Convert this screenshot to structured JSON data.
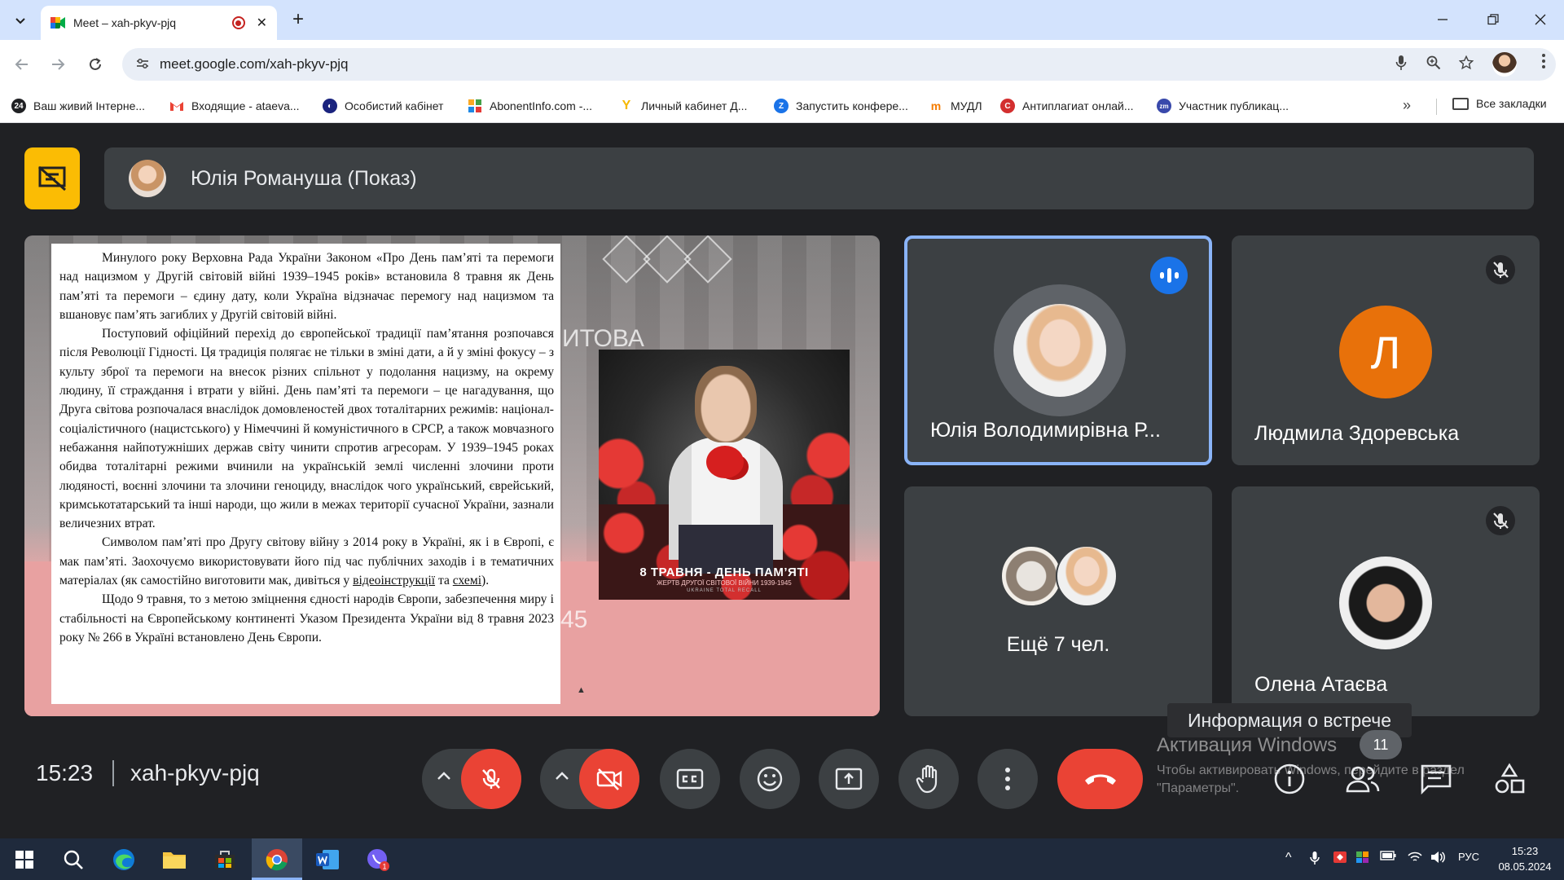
{
  "browser": {
    "tab_title": "Meet – xah-pkyv-pjq",
    "tab_close": "✕",
    "new_tab": "+",
    "url": "meet.google.com/xah-pkyv-pjq",
    "window": {
      "minimize": "—",
      "restore": "❐",
      "close": "✕"
    }
  },
  "bookmarks": {
    "items": [
      {
        "label": "Ваш живий Інтерне...",
        "icon": "24-icon",
        "color": "#202124"
      },
      {
        "label": "Входящие - ataeva...",
        "icon": "gmail-icon",
        "color": "#ea4335"
      },
      {
        "label": "Особистий кабінет",
        "icon": "globe-icon",
        "color": "#1a237e"
      },
      {
        "label": "AbonentInfo.com -...",
        "icon": "grid-icon",
        "color": "#f9a825"
      },
      {
        "label": "Личный кабинет Д...",
        "icon": "y-icon",
        "color": "#f6b800"
      },
      {
        "label": "Запустить конфере...",
        "icon": "z-icon",
        "color": "#1a73e8"
      },
      {
        "label": "МУДЛ",
        "icon": "moodle-icon",
        "color": "#f57c00"
      },
      {
        "label": "Антиплагиат онлай...",
        "icon": "c-icon",
        "color": "#d32f2f"
      },
      {
        "label": "Участник публикац...",
        "icon": "zm-icon",
        "color": "#3949ab"
      }
    ],
    "more": "»",
    "all": "Все закладки"
  },
  "meet": {
    "presenter_label": "Юлія Романуша (Показ)",
    "slide": {
      "bg_text_1": "ИТОВА",
      "bg_text_2": "45",
      "paragraphs": [
        "Минулого року Верховна Рада України Законом «Про День пам’яті та перемоги над нацизмом у Другій світовій війні 1939–1945 років» встановила 8 травня як День пам’яті та перемоги – єдину дату, коли Україна відзначає перемогу над нацизмом та вшановує пам’ять загиблих у Другій світовій війні.",
        "Поступовий офіційний перехід до європейської традиції пам’ятання розпочався після Революції Гідності. Ця традиція полягає не тільки в зміні дати, а й у зміні фокусу – з культу зброї та перемоги на внесок різних спільнот у подолання нацизму, на окрему людину, її страждання і втрати у війні. День пам’яті та перемоги – це нагадування, що Друга світова розпочалася внаслідок домовленостей двох тоталітарних режимів: націонал-соціалістичного (нацистського) у Німеччині й комуністичного в СРСР, а також мовчазного небажання найпотужніших держав світу чинити спротив агресорам. У 1939–1945 роках обидва тоталітарні режими вчинили на українській землі численні злочини проти людяності, воєнні злочини та злочини геноциду, внаслідок чого український, єврейський, кримськотатарський та інші народи, що жили в межах території сучасної України, зазнали величезних втрат.",
        "Символом пам’яті про Другу світову війну з 2014 року в Україні, як і в Європі, є мак пам’яті. Заохочуємо використовувати його під час публічних заходів і в тематичних матеріалах (як самостійно виготовити мак, дивіться у",
        "Щодо 9 травня, то з метою зміцнення єдності народів Європи, забезпечення миру і стабільності на Європейському континенті Указом Президента України від 8 травня 2023 року № 266 в Україні встановлено День Європи."
      ],
      "link_video": "відеоінструкції",
      "link_and": " та ",
      "link_scheme": "схемі",
      "link_end": ").",
      "poster_caption": "8 ТРАВНЯ - ДЕНЬ ПАМ’ЯТІ",
      "poster_sub": "ЖЕРТВ ДРУГОЇ СВІТОВОЇ ВІЙНИ 1939-1945",
      "poster_brand": "UKRAINE TOTAL RECALL"
    },
    "tiles": [
      {
        "name": "Юлія Володимирівна Р...",
        "state": "speaking"
      },
      {
        "name": "Людмила Здоревська",
        "initial": "Л",
        "state": "muted"
      },
      {
        "name": "Ещё 7 чел.",
        "state": "group"
      },
      {
        "name": "Олена Атаєва",
        "state": "muted"
      }
    ],
    "tooltip": "Информация о встрече",
    "participants_badge": "11",
    "watermark_title": "Активация Windows",
    "watermark_text": "Чтобы активировать Windows, перейдите в раздел \"Параметры\".",
    "clock": "15:23",
    "meeting_code": "xah-pkyv-pjq"
  },
  "taskbar": {
    "lang": "РУС",
    "time": "15:23",
    "date": "08.05.2024",
    "viber_badge": "1"
  },
  "colors": {
    "accent_blue": "#8ab4f8",
    "red": "#ea4335",
    "present_yellow": "#fbbc04",
    "tile": "#3c4043",
    "bg": "#202124"
  }
}
